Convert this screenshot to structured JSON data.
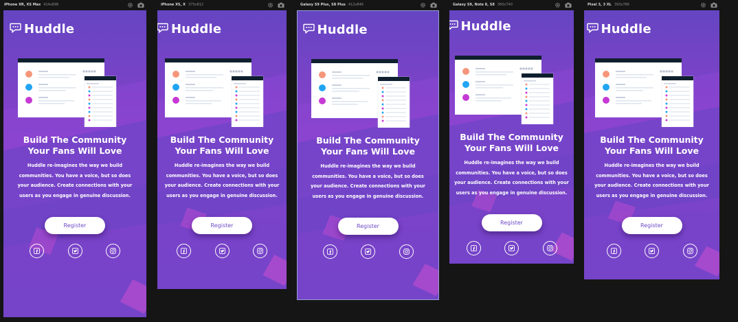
{
  "devices": [
    {
      "name": "iPhone XR, XS Max",
      "size": "414x896"
    },
    {
      "name": "iPhone XS, X",
      "size": "375x812"
    },
    {
      "name": "Galaxy S9 Plus, S8 Plus",
      "size": "412x846"
    },
    {
      "name": "Galaxy S9, Note 8, S8",
      "size": "360x740"
    },
    {
      "name": "Pixel 3, 3 XL",
      "size": "393x786"
    }
  ],
  "brand": {
    "name": "Huddle"
  },
  "hero": {
    "title_line1": "Build The Community",
    "title_line2": "Your Fans Will Love",
    "description": "Huddle re-imagines the way we build communities. You have a voice, but so does your audience. Create connections with your users as you engage in genuine discussion."
  },
  "cta": {
    "register_label": "Register"
  },
  "social": [
    "facebook-icon",
    "twitter-icon",
    "instagram-icon"
  ],
  "colors": {
    "background_start": "#6545c2",
    "background_end": "#8b41cb",
    "button_text": "#6c49c5",
    "card_header": "#0f1f2e"
  }
}
